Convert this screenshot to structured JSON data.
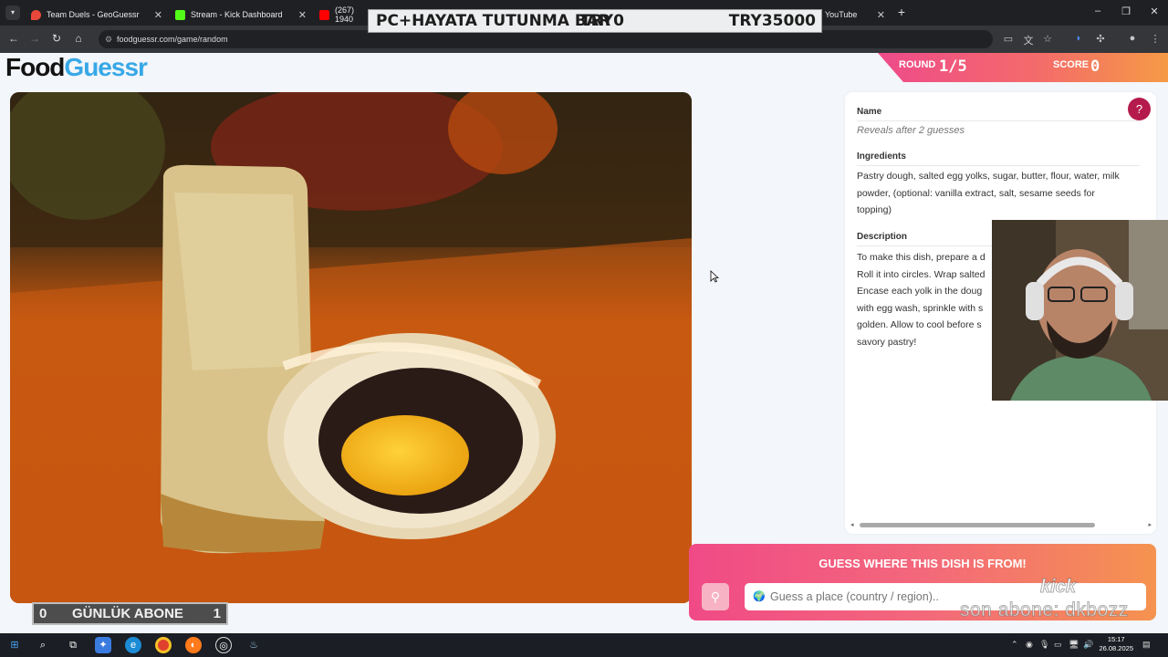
{
  "browser": {
    "tabs": [
      {
        "title": "Team Duels - GeoGuessr",
        "icon": "geoguessr-icon",
        "color": "#e8483a"
      },
      {
        "title": "Stream - Kick Dashboard",
        "icon": "kick-icon",
        "color": "#53fc18"
      },
      {
        "title": "(267) 1940",
        "icon": "youtube-icon",
        "color": "#ff0000"
      },
      {
        "title": "YouTube",
        "icon": "youtube-icon",
        "color": "#ff0000"
      }
    ],
    "new_tab_symbol": "+",
    "url": "foodguessr.com/game/random"
  },
  "stream_overlay": {
    "donation_goal_title": "PC+HAYATA TUTUNMA BAR",
    "donation_current": "TRY0",
    "donation_target": "TRY35000",
    "daily_subs_left": "0",
    "daily_subs_label": "GÜNLÜK ABONE",
    "daily_subs_right": "1",
    "last_sub": "son abone: dkbozz",
    "kick_logo_text": "kick"
  },
  "header": {
    "logo_part1": "Food",
    "logo_part2": "Guessr",
    "round_label": "ROUND",
    "round_value": "1/5",
    "score_label": "SCORE",
    "score_value": "0"
  },
  "panel": {
    "name_label": "Name",
    "name_value": "Reveals after 2 guesses",
    "ingredients_label": "Ingredients",
    "ingredients_lines": [
      "Pastry dough, salted egg yolks, sugar, butter, flour, water, milk",
      "powder, (optional: vanilla extract, salt, sesame seeds for",
      "topping)"
    ],
    "description_label": "Description",
    "description_lines": [
      "To make this dish, prepare a d",
      "Roll it into circles. Wrap salted",
      "Encase each yolk in the doug",
      "with egg wash, sprinkle with s",
      "golden. Allow to cool before s",
      "savory pastry!"
    ]
  },
  "guess": {
    "title": "GUESS WHERE THIS DISH IS FROM!",
    "placeholder": "Guess a place (country / region).."
  },
  "taskbar": {
    "time": "15:17",
    "date": "26.08.2025"
  },
  "colors": {
    "brand_blue": "#38a8e6",
    "accent_pink": "#f04a86",
    "accent_orange": "#f5934f"
  }
}
